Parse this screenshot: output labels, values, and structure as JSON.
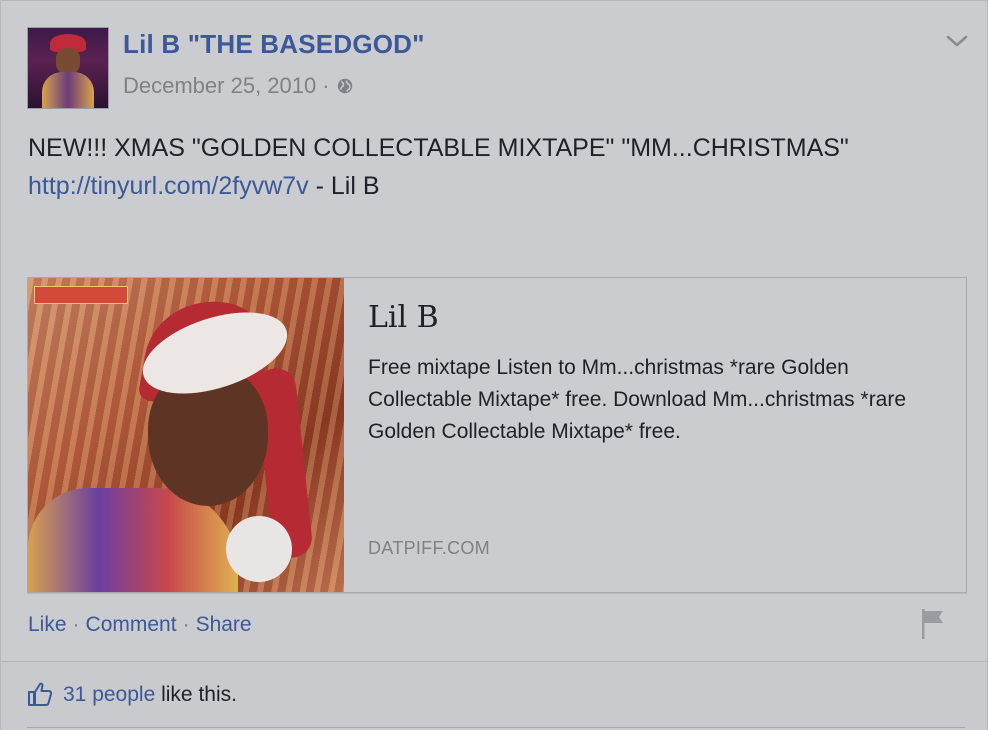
{
  "post": {
    "author": "Lil B \"THE BASEDGOD\"",
    "date": "December 25, 2010",
    "date_separator": "·",
    "message": "NEW!!! XMAS \"GOLDEN COLLECTABLE MIXTAPE\" \"MM...CHRISTMAS\"",
    "link_text": "http://tinyurl.com/2fyvw7v",
    "message_suffix": " - Lil B"
  },
  "preview": {
    "title": "Lil B",
    "description": "Free mixtape Listen to Mm...christmas *rare Golden Collectable Mixtape* free. Download Mm...christmas *rare Golden Collectable Mixtape* free.",
    "domain": "DATPIFF.COM"
  },
  "actions": {
    "like": "Like",
    "comment": "Comment",
    "share": "Share",
    "separator": "·"
  },
  "likes": {
    "count_text": "31 people",
    "suffix": " like this."
  },
  "icons": {
    "audience": "globe-icon",
    "menu": "chevron-down-icon",
    "report": "flag-icon",
    "likes": "like-thumb-icon"
  },
  "colors": {
    "link": "#3b5998",
    "muted": "#7f8187",
    "text": "#1d2129"
  }
}
